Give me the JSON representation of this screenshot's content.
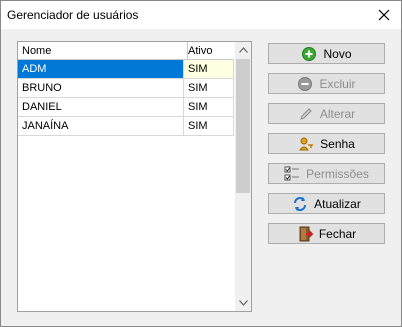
{
  "window": {
    "title": "Gerenciador de usuários"
  },
  "grid": {
    "columns": [
      "Nome",
      "Ativo"
    ],
    "rows": [
      {
        "nome": "ADM",
        "ativo": "SIM"
      },
      {
        "nome": "BRUNO",
        "ativo": "SIM"
      },
      {
        "nome": "DANIEL",
        "ativo": "SIM"
      },
      {
        "nome": "JANAÍNA",
        "ativo": "SIM"
      }
    ],
    "selected_row": 0
  },
  "buttons": {
    "novo": "Novo",
    "excluir": "Excluir",
    "alterar": "Alterar",
    "senha": "Senha",
    "permissoes": "Permissões",
    "atualizar": "Atualizar",
    "fechar": "Fechar"
  },
  "icons": {
    "novo": "plus-circle-icon",
    "excluir": "minus-circle-icon",
    "alterar": "pencil-icon",
    "senha": "key-user-icon",
    "permissoes": "checklist-icon",
    "atualizar": "refresh-icon",
    "fechar": "exit-door-icon"
  },
  "colors": {
    "selection": "#0078d7",
    "selection_cell": "#ffffe1",
    "accent_green": "#3aa935"
  }
}
